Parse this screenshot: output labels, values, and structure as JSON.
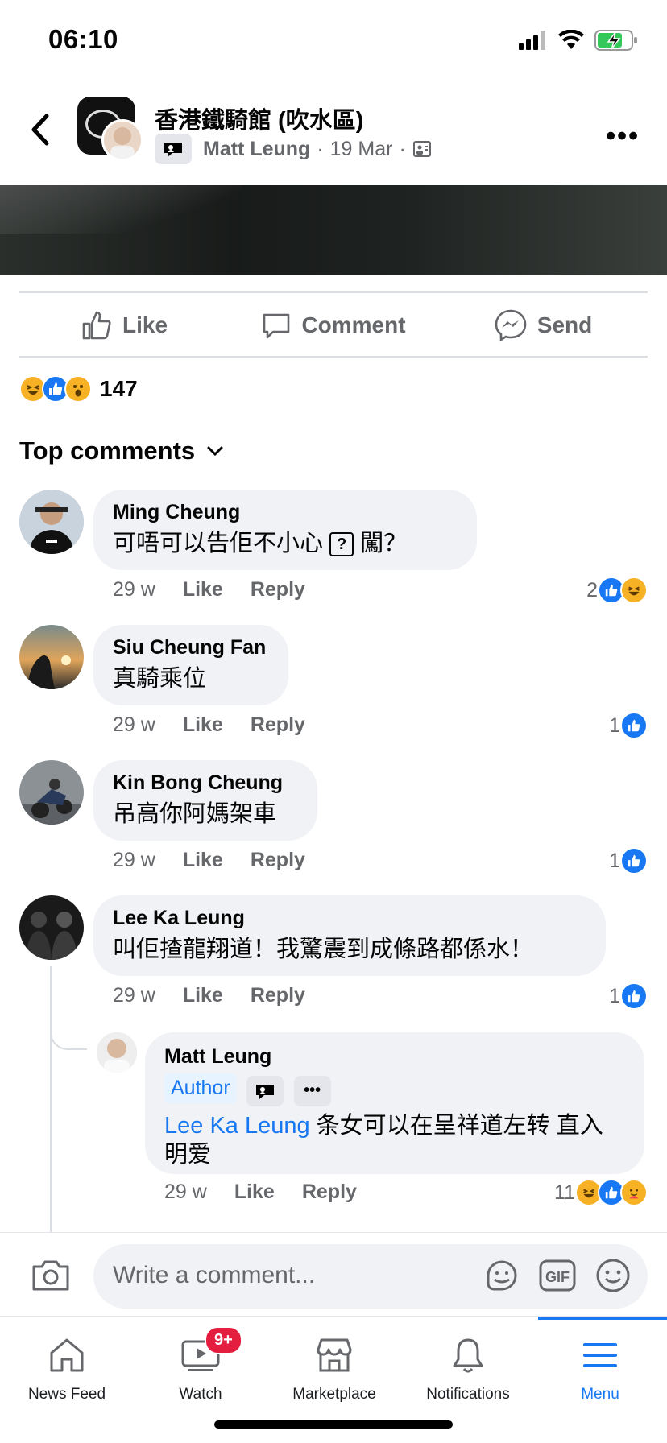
{
  "status_bar": {
    "time": "06:10"
  },
  "header": {
    "group_name": "香港鐵騎館 (吹水區)",
    "author": "Matt Leung",
    "date": "19 Mar",
    "separator": "·"
  },
  "actions": {
    "like": "Like",
    "comment": "Comment",
    "send": "Send"
  },
  "reactions_summary": {
    "count": "147"
  },
  "comments_header": "Top comments",
  "comments": [
    {
      "name": "Ming Cheung",
      "text_before": "可唔可以告佢不小心",
      "text_after": "闖？",
      "time": "29 w",
      "like": "Like",
      "reply": "Reply",
      "react_count": "2"
    },
    {
      "name": "Siu Cheung Fan",
      "text": "真騎乘位",
      "time": "29 w",
      "like": "Like",
      "reply": "Reply",
      "react_count": "1"
    },
    {
      "name": "Kin Bong Cheung",
      "text": "吊高你阿媽架車",
      "time": "29 w",
      "like": "Like",
      "reply": "Reply",
      "react_count": "1"
    },
    {
      "name": "Lee Ka Leung",
      "text": "叫佢揸龍翔道！我驚震到成條路都係水！",
      "time": "29 w",
      "like": "Like",
      "reply": "Reply",
      "react_count": "1"
    }
  ],
  "reply": {
    "name": "Matt Leung",
    "author_badge": "Author",
    "mention": "Lee Ka Leung",
    "text": " 条女可以在呈祥道左转 直入明爱",
    "time": "29 w",
    "like": "Like",
    "reply": "Reply",
    "react_count": "11"
  },
  "composer": {
    "placeholder": "Write a comment..."
  },
  "bottom_nav": {
    "items": [
      {
        "label": "News Feed"
      },
      {
        "label": "Watch",
        "badge": "9+"
      },
      {
        "label": "Marketplace"
      },
      {
        "label": "Notifications"
      },
      {
        "label": "Menu"
      }
    ]
  },
  "colors": {
    "accent": "#1877f2",
    "badge_red": "#e41e3f",
    "bubble": "#f0f2f5",
    "secondary_text": "#65676b"
  }
}
